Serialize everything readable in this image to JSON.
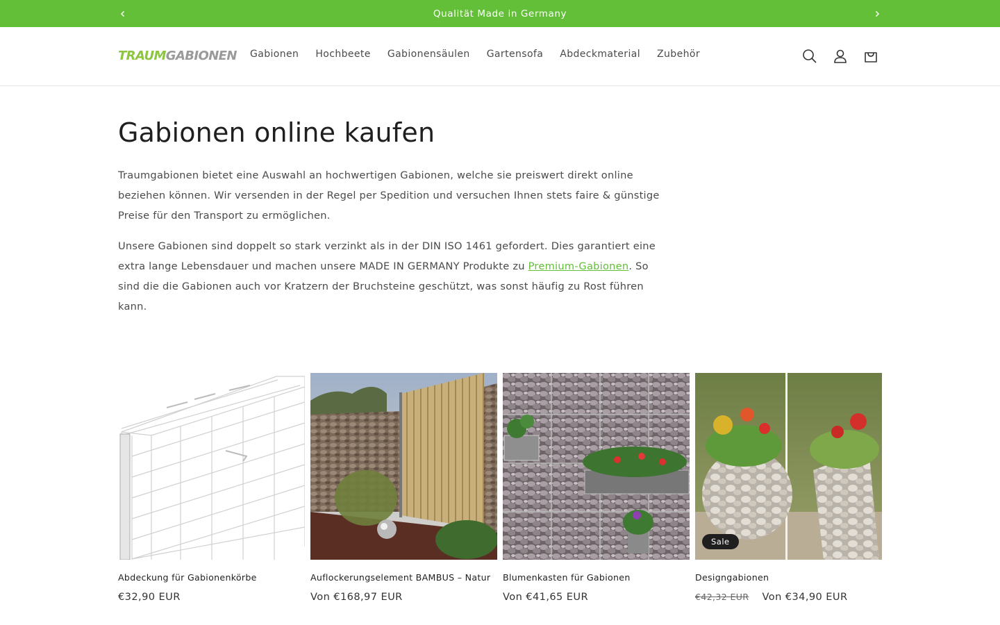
{
  "announcement": {
    "text": "Qualität Made in Germany"
  },
  "logo": {
    "part1": "TRAUM",
    "part2": "GABIONEN"
  },
  "nav": [
    {
      "label": "Gabionen"
    },
    {
      "label": "Hochbeete"
    },
    {
      "label": "Gabionensäulen"
    },
    {
      "label": "Gartensofa"
    },
    {
      "label": "Abdeckmaterial"
    },
    {
      "label": "Zubehör"
    }
  ],
  "header_icons": [
    "search-icon",
    "account-icon",
    "cart-icon"
  ],
  "main": {
    "title": "Gabionen online kaufen",
    "paragraph1": "Traumgabionen bietet eine Auswahl an hochwertigen Gabionen, welche sie preiswert direkt online beziehen können. Wir versenden in der Regel per Spedition und versuchen Ihnen stets faire & günstige Preise für den Transport zu ermöglichen.",
    "paragraph2_before": "Unsere Gabionen sind doppelt so stark verzinkt als in der DIN ISO 1461 gefordert. Dies garantiert eine extra lange Lebensdauer und machen unsere MADE IN GERMANY Produkte zu ",
    "paragraph2_link": "Premium-Gabionen",
    "paragraph2_after": ". So sind die die Gabionen auch vor Kratzern der Bruchsteine geschützt, was sonst häufig zu Rost führen kann."
  },
  "products": [
    {
      "name": "Abdeckung für Gabionenkörbe",
      "price": "€32,90 EUR",
      "old_price": "",
      "badge": ""
    },
    {
      "name": "Auflockerungselement BAMBUS – Natur",
      "price": "Von €168,97 EUR",
      "old_price": "",
      "badge": ""
    },
    {
      "name": "Blumenkasten für Gabionen",
      "price": "Von €41,65 EUR",
      "old_price": "",
      "badge": ""
    },
    {
      "name": "Designgabionen",
      "price": "Von €34,90 EUR",
      "old_price": "€42,32 EUR",
      "badge": "Sale"
    }
  ],
  "colors": {
    "accent": "#62bf37",
    "text": "#1f1f1f",
    "badge": "#1f1f1f"
  }
}
